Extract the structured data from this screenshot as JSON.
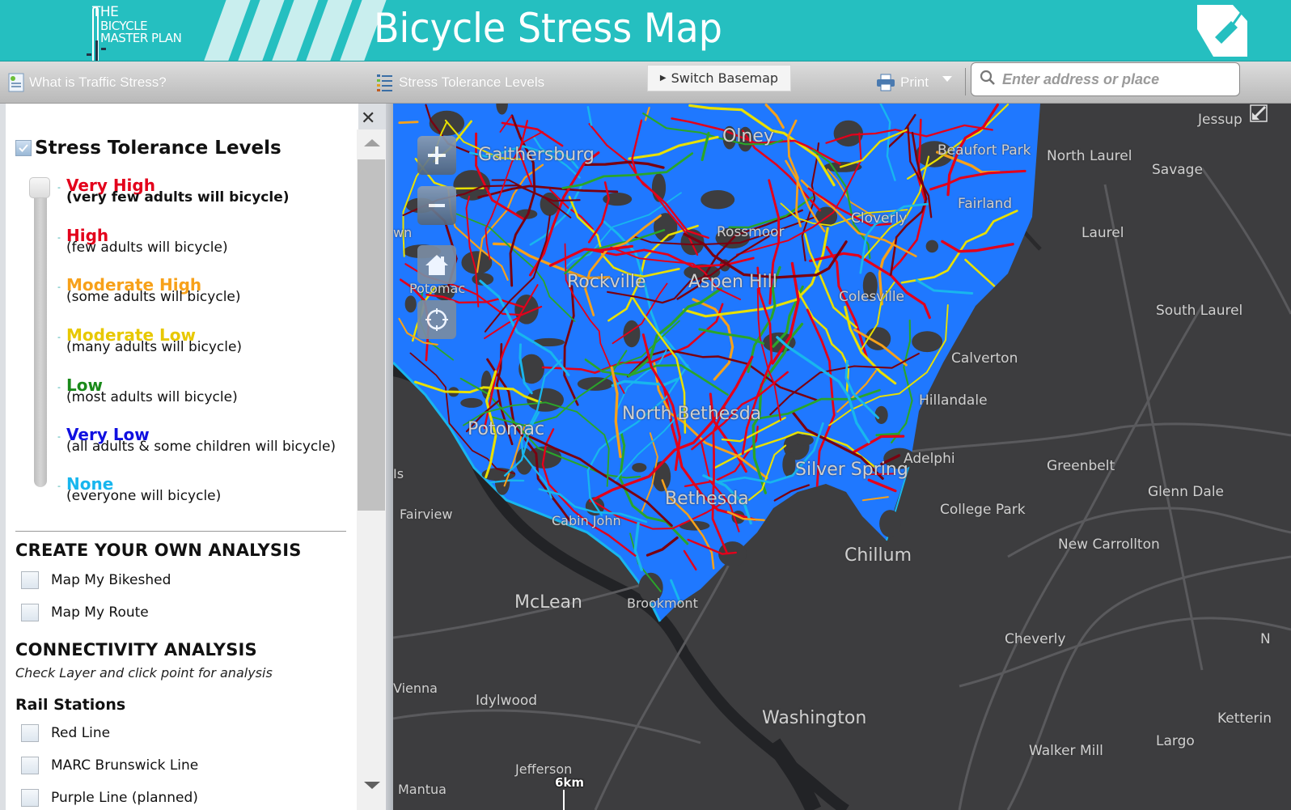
{
  "header": {
    "logo_line1": "THE",
    "logo_line2": "BICYCLE",
    "logo_line3": "MASTER PLAN",
    "title": "Bicycle Stress Map",
    "brand_color": "#25bfc0"
  },
  "toolbar": {
    "what_is_label": "What is Traffic Stress?",
    "levels_label": "Stress Tolerance Levels",
    "basemap_label": "Switch Basemap",
    "print_label": "Print",
    "search_placeholder": "Enter address or place"
  },
  "panel": {
    "layer_title": "Stress Tolerance Levels",
    "layer_checked": true,
    "levels": [
      {
        "name": "Very High",
        "desc": "(very few adults will bicycle)",
        "color": "#e3001b"
      },
      {
        "name": "High",
        "desc": "(few adults will bicycle)",
        "color": "#e3001b"
      },
      {
        "name": "Moderate High",
        "desc": "(some adults will bicycle)",
        "color": "#f7a11a"
      },
      {
        "name": "Moderate Low",
        "desc": "(many adults will bicycle)",
        "color": "#e8c800"
      },
      {
        "name": "Low",
        "desc": "(most adults will bicycle)",
        "color": "#1a8a1a"
      },
      {
        "name": "Very Low",
        "desc": "(all adults & some children will bicycle)",
        "color": "#1010e0"
      },
      {
        "name": "None",
        "desc": "(everyone will bicycle)",
        "color": "#18b6ee"
      }
    ],
    "selected_level": "Very High",
    "create_heading": "CREATE YOUR OWN ANALYSIS",
    "create_items": [
      {
        "label": "Map My Bikeshed",
        "checked": false
      },
      {
        "label": "Map My Route",
        "checked": false
      }
    ],
    "connectivity_heading": "CONNECTIVITY ANALYSIS",
    "connectivity_note": "Check Layer and click point for analysis",
    "rail_heading": "Rail Stations",
    "rail_items": [
      {
        "label": "Red Line",
        "checked": false
      },
      {
        "label": "MARC Brunswick Line",
        "checked": false
      },
      {
        "label": "Purple Line (planned)",
        "checked": false
      }
    ]
  },
  "map": {
    "scale_label": "6km",
    "places": [
      {
        "name": "Gaithersburg",
        "size": "big"
      },
      {
        "name": "Olney",
        "size": "big"
      },
      {
        "name": "Beaufort Park",
        "size": "med"
      },
      {
        "name": "North Laurel",
        "size": "med"
      },
      {
        "name": "Jessup",
        "size": "med"
      },
      {
        "name": "Savage",
        "size": "med"
      },
      {
        "name": "Fairland",
        "size": "med"
      },
      {
        "name": "Cloverly",
        "size": "med"
      },
      {
        "name": "Rossmoor",
        "size": "med"
      },
      {
        "name": "Laurel",
        "size": "med"
      },
      {
        "name": "Rockville",
        "size": "big"
      },
      {
        "name": "Aspen Hill",
        "size": "big"
      },
      {
        "name": "Colesville",
        "size": "med"
      },
      {
        "name": "South Laurel",
        "size": "med"
      },
      {
        "name": "Potomac",
        "size": "sm"
      },
      {
        "name": "Calverton",
        "size": "med"
      },
      {
        "name": "Hillandale",
        "size": "med"
      },
      {
        "name": "North Bethesda",
        "size": "big"
      },
      {
        "name": "Potomac",
        "size": "big"
      },
      {
        "name": "Adelphi",
        "size": "med"
      },
      {
        "name": "Greenbelt",
        "size": "med"
      },
      {
        "name": "Silver Spring",
        "size": "big"
      },
      {
        "name": "Glenn Dale",
        "size": "med"
      },
      {
        "name": "Bethesda",
        "size": "big"
      },
      {
        "name": "Fairview",
        "size": "sm"
      },
      {
        "name": "Cabin John",
        "size": "sm"
      },
      {
        "name": "College Park",
        "size": "med"
      },
      {
        "name": "New Carrollton",
        "size": "med"
      },
      {
        "name": "Chillum",
        "size": "big"
      },
      {
        "name": "McLean",
        "size": "big"
      },
      {
        "name": "Brookmont",
        "size": "sm"
      },
      {
        "name": "Cheverly",
        "size": "med"
      },
      {
        "name": "Vienna",
        "size": "sm"
      },
      {
        "name": "Idylwood",
        "size": "med"
      },
      {
        "name": "Washington",
        "size": "big"
      },
      {
        "name": "Ketterin",
        "size": "med"
      },
      {
        "name": "Largo",
        "size": "med"
      },
      {
        "name": "Walker Mill",
        "size": "med"
      },
      {
        "name": "Jefferson",
        "size": "sm"
      },
      {
        "name": "Mantua",
        "size": "sm"
      },
      {
        "name": "Is",
        "size": "sm"
      },
      {
        "name": "wn",
        "size": "sm"
      },
      {
        "name": "N",
        "size": "med"
      }
    ]
  }
}
